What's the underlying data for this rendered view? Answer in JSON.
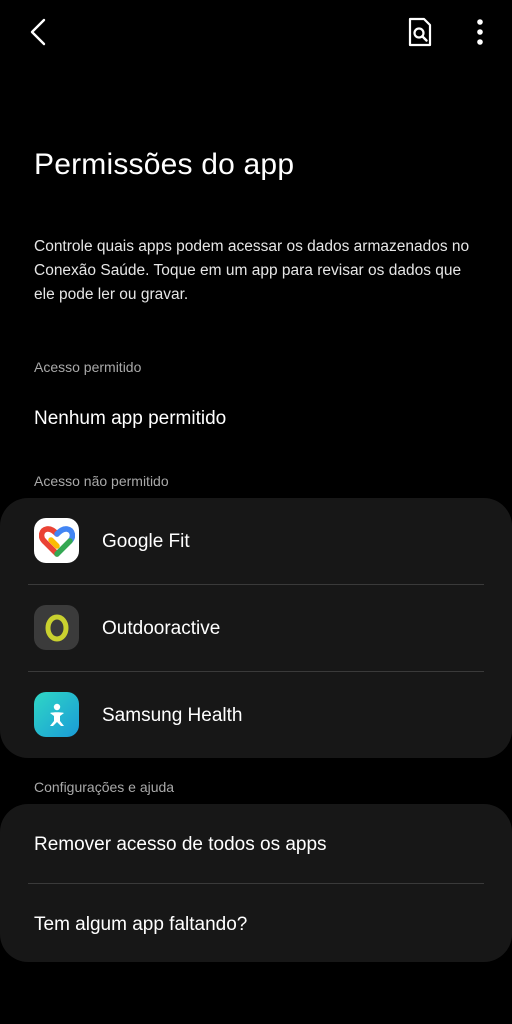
{
  "header": {
    "back_icon": "chevron-left-icon",
    "search_icon": "search-page-icon",
    "more_icon": "more-vertical-icon"
  },
  "page": {
    "title": "Permissões do app",
    "description": "Controle quais apps podem acessar os dados armazenados no Conexão Saúde. Toque em um app para revisar os dados que ele pode ler ou gravar."
  },
  "allowed": {
    "header": "Acesso permitido",
    "empty_text": "Nenhum app permitido"
  },
  "denied": {
    "header": "Acesso não permitido",
    "apps": [
      {
        "name": "Google Fit",
        "icon": "google-fit-icon"
      },
      {
        "name": "Outdooractive",
        "icon": "outdooractive-icon"
      },
      {
        "name": "Samsung Health",
        "icon": "samsung-health-icon"
      }
    ]
  },
  "settings": {
    "header": "Configurações e ajuda",
    "items": [
      {
        "label": "Remover acesso de todos os apps"
      },
      {
        "label": "Tem algum app faltando?"
      }
    ]
  },
  "colors": {
    "background": "#000000",
    "card": "#171717",
    "divider": "#3a3a3a",
    "secondary_text": "#a9a9a9"
  }
}
